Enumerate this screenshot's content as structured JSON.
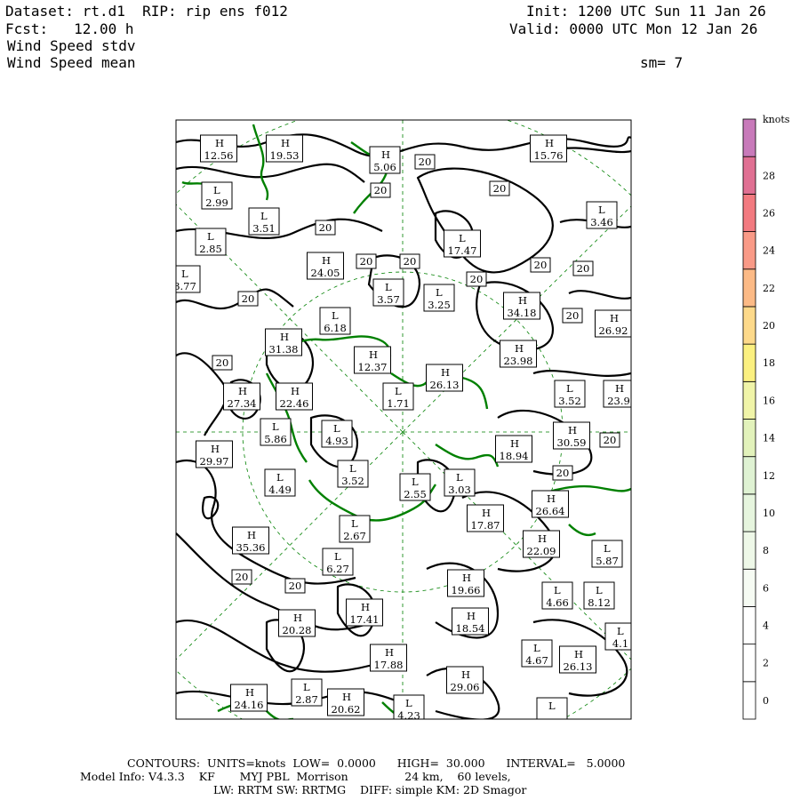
{
  "header": {
    "dataset_line": "Dataset: rt.d1  RIP: rip ens f012",
    "fcst_line": "Fcst:   12.00 h",
    "field1": "Wind Speed stdv",
    "field2": "Wind Speed mean",
    "init_line": "Init: 1200 UTC Sun 11 Jan 26",
    "valid_line": "Valid: 0000 UTC Mon 12 Jan 26",
    "sm_line": "sm= 7"
  },
  "footer": {
    "contours_line": "CONTOURS:  UNITS=knots  LOW=  0.0000      HIGH=  30.000      INTERVAL=   5.0000",
    "model_line": "Model Info: V4.3.3    KF       MYJ PBL  Morrison                24 km,    60 levels,",
    "physics_line": "LW: RRTM SW: RRTMG    DIFF: simple KM: 2D Smagor"
  },
  "colors": {
    "contour": "#000000",
    "coast": "#008000",
    "grid": "#008000"
  },
  "chart_data": {
    "type": "contour-map",
    "units": "knots",
    "contour_low": 0.0,
    "contour_high": 30.0,
    "contour_interval": 5.0,
    "colorbar": {
      "unit_label": "knots",
      "levels": [
        "0",
        "2",
        "4",
        "6",
        "8",
        "10",
        "12",
        "14",
        "16",
        "18",
        "20",
        "22",
        "24",
        "26",
        "28"
      ],
      "colors": [
        "#ffffff",
        "#ffffff",
        "#ffffff",
        "#f6fbf3",
        "#eef8e8",
        "#e6f5de",
        "#dff2d3",
        "#e2f2bb",
        "#f0f4a8",
        "#fbf080",
        "#fdd98a",
        "#fcba86",
        "#f99a87",
        "#f27a80",
        "#e07093",
        "#c87aba"
      ]
    },
    "extrema": [
      {
        "t": "H",
        "v": "12.56"
      },
      {
        "t": "H",
        "v": "19.53"
      },
      {
        "t": "H",
        "v": "5.06"
      },
      {
        "t": "H",
        "v": "15.76"
      },
      {
        "t": "L",
        "v": "2.99"
      },
      {
        "t": "L",
        "v": "3.51"
      },
      {
        "t": "L",
        "v": "3.46"
      },
      {
        "t": "L",
        "v": "2.85"
      },
      {
        "t": "L",
        "v": "17.47"
      },
      {
        "t": "H",
        "v": "24.05"
      },
      {
        "t": "L",
        "v": "3.77"
      },
      {
        "t": "L",
        "v": "3.57"
      },
      {
        "t": "L",
        "v": "3.25"
      },
      {
        "t": "H",
        "v": "34.18"
      },
      {
        "t": "H",
        "v": "26.92"
      },
      {
        "t": "L",
        "v": "6.18"
      },
      {
        "t": "H",
        "v": "31.38"
      },
      {
        "t": "H",
        "v": "23.98"
      },
      {
        "t": "H",
        "v": "12.37"
      },
      {
        "t": "H",
        "v": "26.13"
      },
      {
        "t": "H",
        "v": "27.34"
      },
      {
        "t": "H",
        "v": "22.46"
      },
      {
        "t": "L",
        "v": "1.71"
      },
      {
        "t": "L",
        "v": "3.52"
      },
      {
        "t": "H",
        "v": "23.9"
      },
      {
        "t": "L",
        "v": "5.86"
      },
      {
        "t": "L",
        "v": "4.93"
      },
      {
        "t": "H",
        "v": "30.59"
      },
      {
        "t": "H",
        "v": "29.97"
      },
      {
        "t": "H",
        "v": "18.94"
      },
      {
        "t": "L",
        "v": "4.49"
      },
      {
        "t": "L",
        "v": "3.52"
      },
      {
        "t": "L",
        "v": "2.55"
      },
      {
        "t": "L",
        "v": "3.03"
      },
      {
        "t": "H",
        "v": "26.64"
      },
      {
        "t": "H",
        "v": "17.87"
      },
      {
        "t": "H",
        "v": "35.36"
      },
      {
        "t": "L",
        "v": "2.67"
      },
      {
        "t": "H",
        "v": "22.09"
      },
      {
        "t": "L",
        "v": "6.27"
      },
      {
        "t": "L",
        "v": "5.87"
      },
      {
        "t": "H",
        "v": "19.66"
      },
      {
        "t": "L",
        "v": "4.66"
      },
      {
        "t": "L",
        "v": "8.12"
      },
      {
        "t": "H",
        "v": "17.41"
      },
      {
        "t": "H",
        "v": "20.28"
      },
      {
        "t": "H",
        "v": "18.54"
      },
      {
        "t": "L",
        "v": "4.1"
      },
      {
        "t": "H",
        "v": "17.88"
      },
      {
        "t": "L",
        "v": "4.67"
      },
      {
        "t": "H",
        "v": "26.13"
      },
      {
        "t": "H",
        "v": "29.06"
      },
      {
        "t": "H",
        "v": "24.16"
      },
      {
        "t": "L",
        "v": "2.87"
      },
      {
        "t": "H",
        "v": "20.62"
      },
      {
        "t": "L",
        "v": "4.23"
      },
      {
        "t": "L",
        "v": ""
      }
    ],
    "contour_labels": [
      "20",
      "20",
      "20",
      "20",
      "20",
      "20",
      "20",
      "20",
      "20",
      "20",
      "20",
      "20",
      "20",
      "20",
      "20",
      "20",
      "20",
      "20"
    ]
  }
}
